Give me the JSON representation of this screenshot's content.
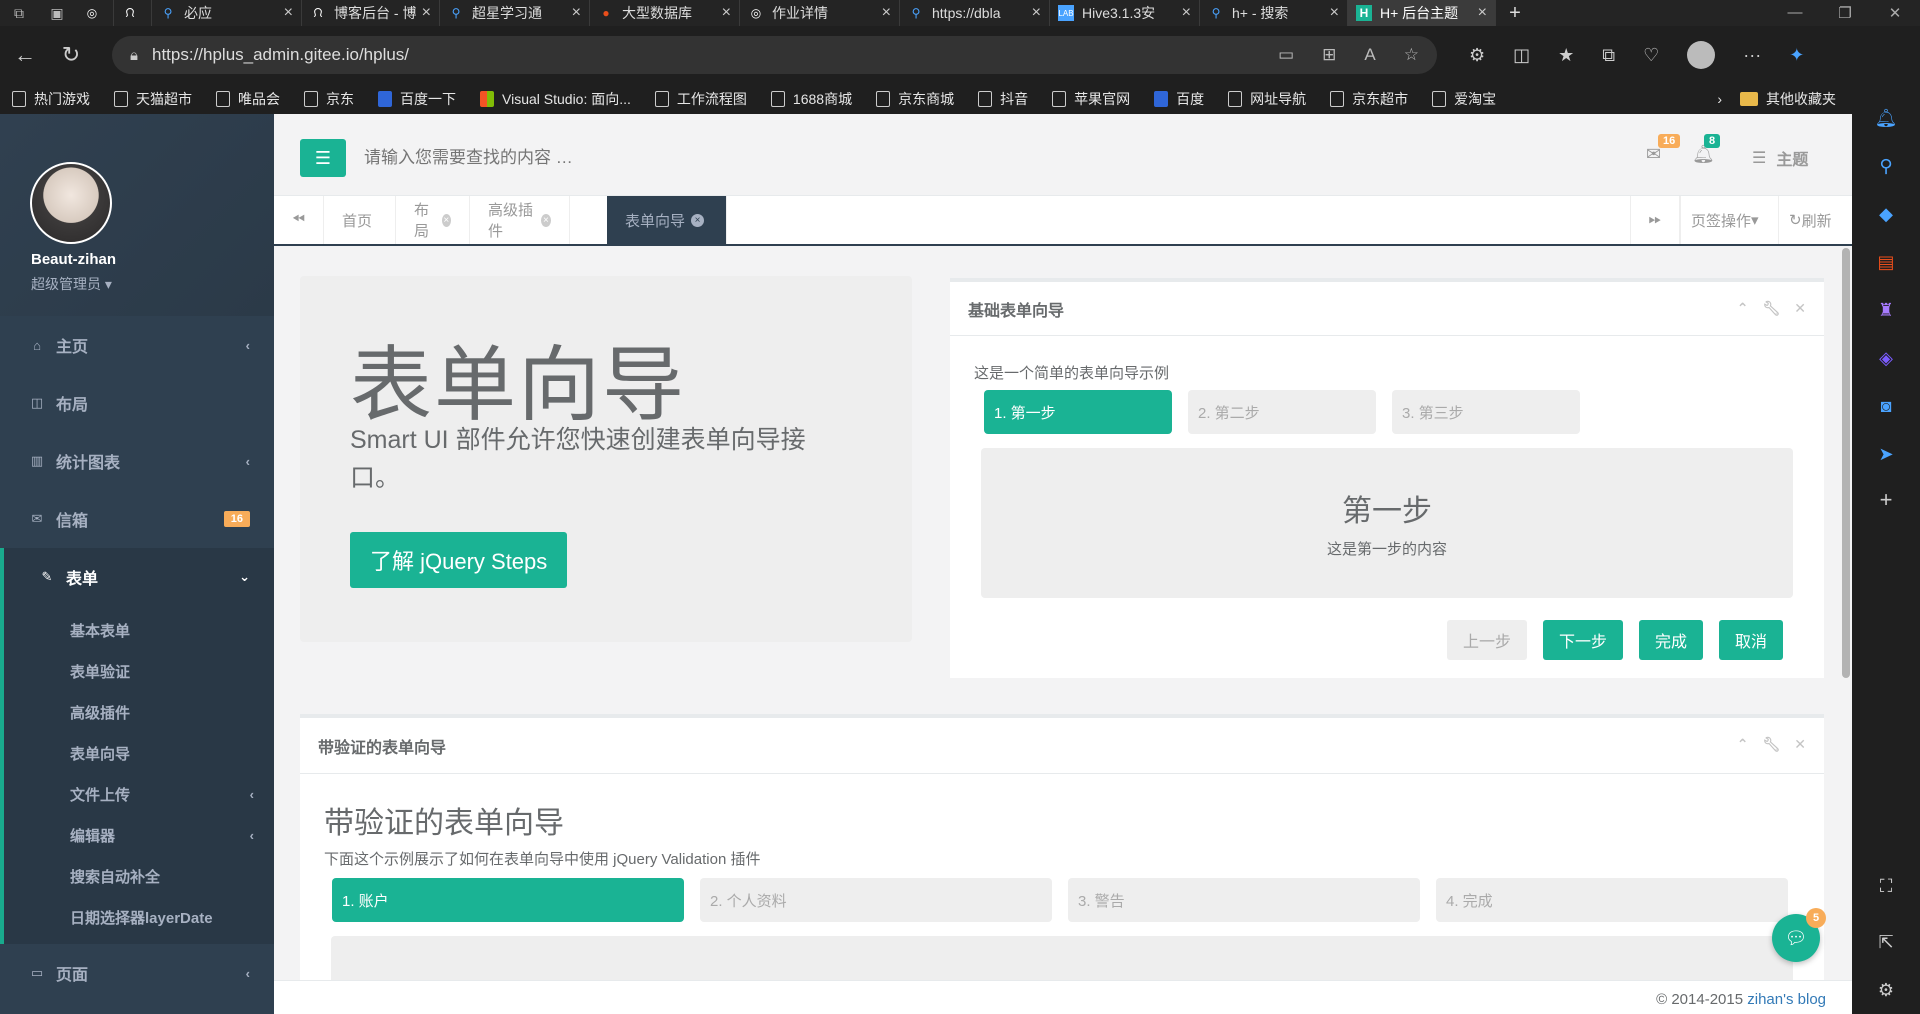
{
  "browser": {
    "tabs": [
      {
        "title": "必应",
        "fav": "search-icon",
        "color": "#4aa3ff"
      },
      {
        "title": "博客后台 - 博",
        "fav": "blog-icon",
        "color": "#888"
      },
      {
        "title": "超星学习通",
        "fav": "search-icon",
        "color": "#4aa3ff"
      },
      {
        "title": "大型数据库",
        "fav": "db-icon",
        "color": "#e94e1b"
      },
      {
        "title": "作业详情",
        "fav": "globe-icon",
        "color": "#999"
      },
      {
        "title": "https://dbla",
        "fav": "search-icon",
        "color": "#4aa3ff"
      },
      {
        "title": "Hive3.1.3安",
        "fav": "lab-icon",
        "color": "#4aa3ff"
      },
      {
        "title": "h+ - 搜索",
        "fav": "search-icon",
        "color": "#4aa3ff"
      },
      {
        "title": "H+ 后台主题",
        "fav": "hplus-icon",
        "color": "#1ab394"
      }
    ],
    "url": "https://hplus_admin.gitee.io/hplus/",
    "bookmarks": [
      "热门游戏",
      "天猫超市",
      "唯品会",
      "京东",
      "百度一下",
      "Visual Studio: 面向...",
      "工作流程图",
      "1688商城",
      "京东商城",
      "抖音",
      "苹果官网",
      "百度",
      "网址导航",
      "京东超市",
      "爱淘宝"
    ],
    "other_bookmarks": "其他收藏夹"
  },
  "sidebar": {
    "username": "Beaut-zihan",
    "role": "超级管理员",
    "menu": [
      {
        "label": "主页",
        "icon": "home-icon",
        "arrow": true
      },
      {
        "label": "布局",
        "icon": "columns-icon",
        "arrow": false
      },
      {
        "label": "统计图表",
        "icon": "bar-chart-icon",
        "arrow": true
      },
      {
        "label": "信箱",
        "icon": "envelope-icon",
        "badge": "16"
      },
      {
        "label": "表单",
        "icon": "edit-icon",
        "expanded": true
      }
    ],
    "submenu": [
      {
        "label": "基本表单"
      },
      {
        "label": "表单验证"
      },
      {
        "label": "高级插件"
      },
      {
        "label": "表单向导"
      },
      {
        "label": "文件上传",
        "arrow": true
      },
      {
        "label": "编辑器",
        "arrow": true
      },
      {
        "label": "搜索自动补全"
      },
      {
        "label": "日期选择器layerDate"
      }
    ],
    "after": {
      "label": "页面",
      "icon": "desktop-icon"
    }
  },
  "header": {
    "search_placeholder": "请输入您需要查找的内容 …",
    "mail_count": "16",
    "bell_count": "8",
    "theme_label": "主题"
  },
  "page_tabs": {
    "tabs": [
      {
        "label": "首页",
        "closable": false
      },
      {
        "label": "布局",
        "closable": true
      },
      {
        "label": "高级插件",
        "closable": true
      },
      {
        "label": "表单向导",
        "closable": true,
        "active": true
      }
    ],
    "tab_ops": "页签操作",
    "refresh": "刷新"
  },
  "jumbotron": {
    "title": "表单向导",
    "text": "Smart UI 部件允许您快速创建表单向导接口。",
    "button": "了解 jQuery Steps"
  },
  "basic_wizard": {
    "title": "基础表单向导",
    "desc": "这是一个简单的表单向导示例",
    "steps": [
      "1. 第一步",
      "2. 第二步",
      "3. 第三步"
    ],
    "body_title": "第一步",
    "body_text": "这是第一步的内容",
    "buttons": {
      "prev": "上一步",
      "next": "下一步",
      "finish": "完成",
      "cancel": "取消"
    }
  },
  "validation_wizard": {
    "title": "带验证的表单向导",
    "heading": "带验证的表单向导",
    "desc": "下面这个示例展示了如何在表单向导中使用 jQuery Validation 插件",
    "steps": [
      "1. 账户",
      "2. 个人资料",
      "3. 警告",
      "4. 完成"
    ]
  },
  "footer": {
    "copy": "© 2014-2015",
    "link": "zihan's blog"
  },
  "chat_badge": "5",
  "colors": {
    "accent": "#1ab394",
    "sidebar": "#2f4050",
    "warning": "#f8ac59"
  }
}
